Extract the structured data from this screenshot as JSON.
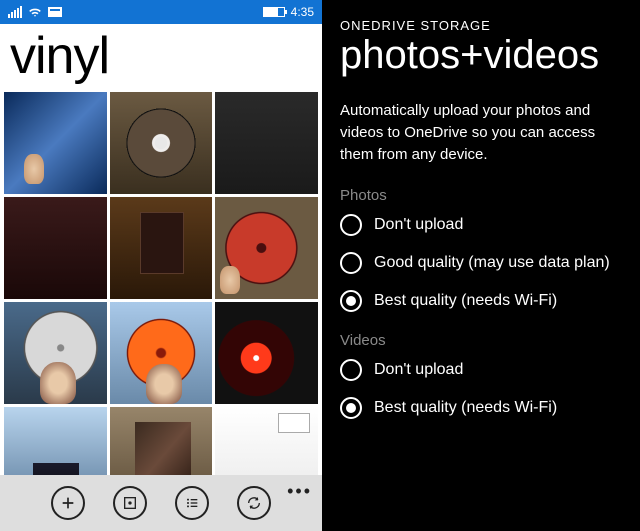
{
  "status": {
    "time": "4:35"
  },
  "album": {
    "title": "vinyl"
  },
  "settings": {
    "header": "ONEDRIVE STORAGE",
    "title": "photos+videos",
    "description": "Automatically upload your photos and videos to OneDrive so you can access them from any device.",
    "groups": [
      {
        "label": "Photos",
        "options": [
          {
            "label": "Don't upload",
            "selected": false
          },
          {
            "label": "Good quality (may use data plan)",
            "selected": false
          },
          {
            "label": "Best quality (needs Wi-Fi)",
            "selected": true
          }
        ]
      },
      {
        "label": "Videos",
        "options": [
          {
            "label": "Don't upload",
            "selected": false
          },
          {
            "label": "Best quality (needs Wi-Fi)",
            "selected": true
          }
        ]
      }
    ]
  },
  "appbar": {
    "icons": [
      "add",
      "select",
      "list",
      "sync"
    ]
  }
}
